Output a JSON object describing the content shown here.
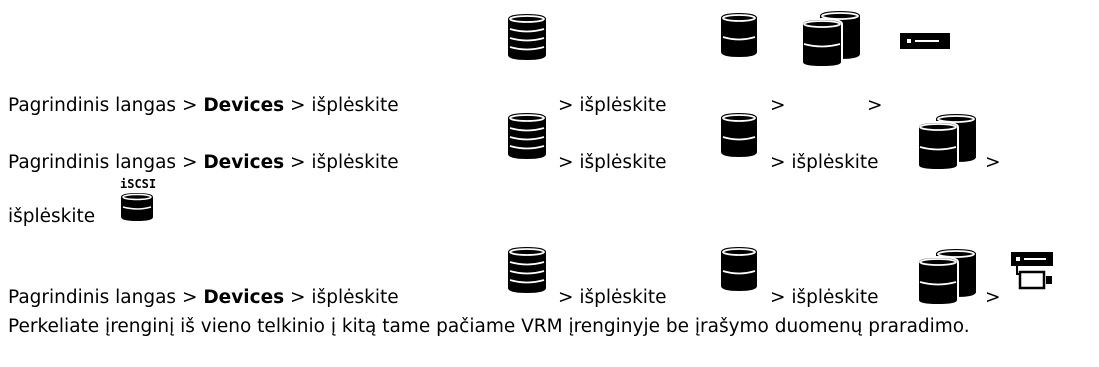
{
  "lines": [
    {
      "prefix": "Pagrindinis langas > ",
      "bold": "Devices",
      "parts": [
        " > išplėskite ",
        " > išplėskite ",
        " > ",
        " >"
      ]
    },
    {
      "prefix": "Pagrindinis langas > ",
      "bold": "Devices",
      "parts": [
        " > išplėskite ",
        " > išplėskite ",
        " > išplėskite ",
        " >"
      ],
      "continuation": "išplėskite"
    },
    {
      "prefix": "Pagrindinis langas > ",
      "bold": "Devices",
      "parts": [
        " > išplėskite ",
        " > išplėskite ",
        " > išplėskite ",
        " >"
      ]
    }
  ],
  "icons": {
    "vrm": "vrm-server-icon",
    "pool": "storage-pool-icon",
    "iscsi_group": "iscsi-device-group-icon",
    "device": "recording-device-icon",
    "iscsi": "iscsi-device-icon",
    "iscsi_label": "iSCSI",
    "move": "move-device-icon",
    "color": "#000000"
  },
  "description": "Perkeliate įrenginį iš vieno telkinio į kitą tame pačiame VRM įrenginyje be įrašymo duomenų praradimo."
}
